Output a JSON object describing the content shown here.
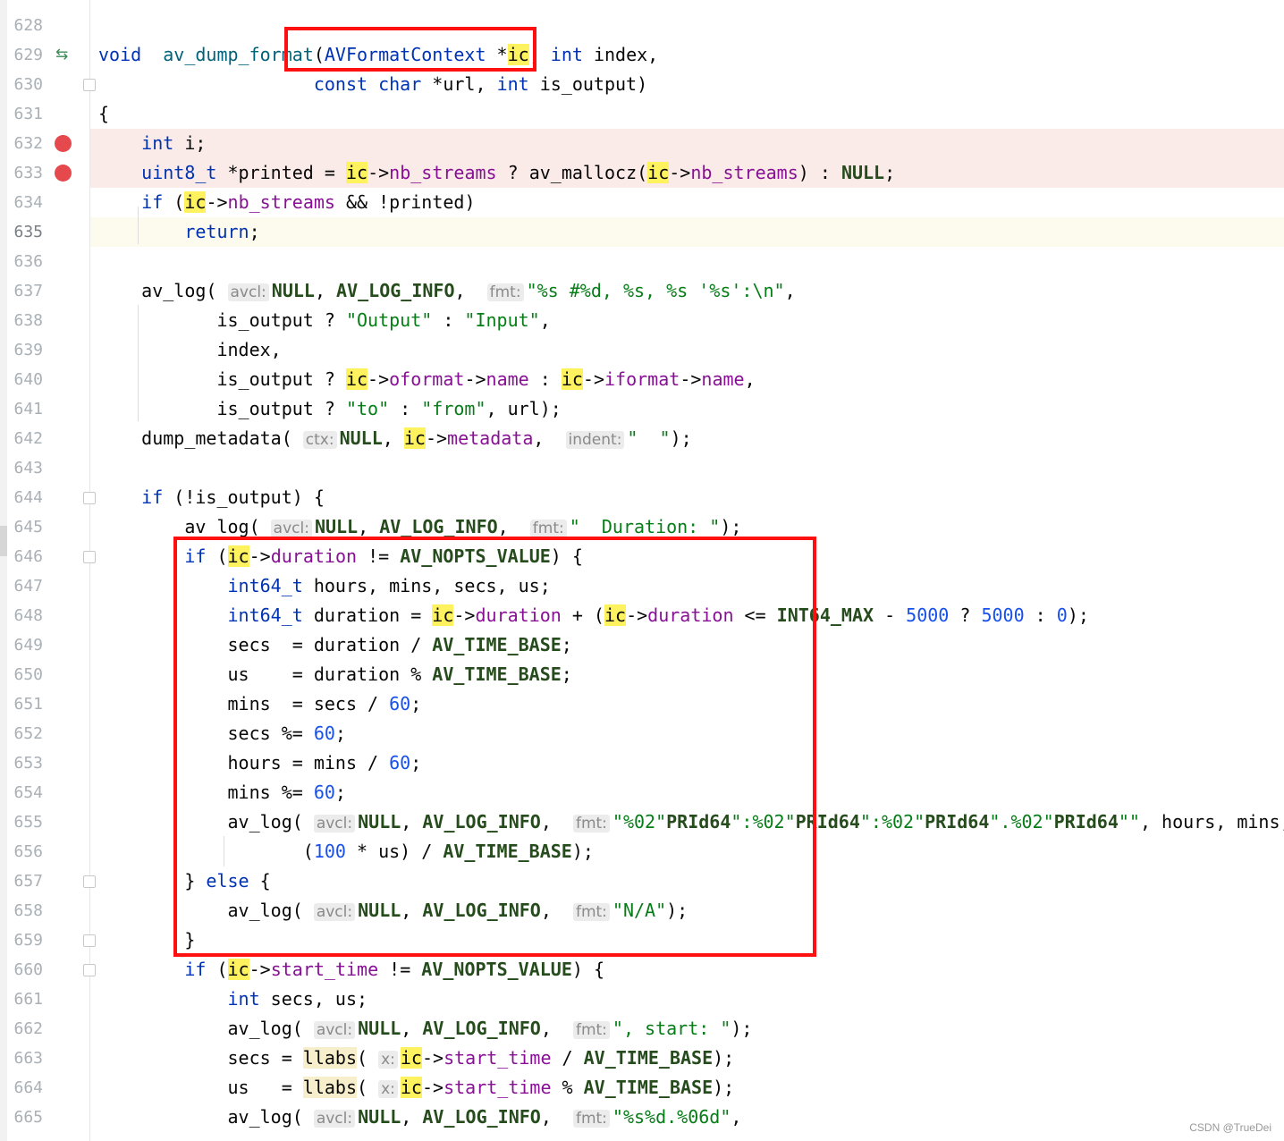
{
  "watermark": "CSDN @TrueDei",
  "rows": [
    {
      "ln": "628",
      "segs": []
    },
    {
      "ln": "629",
      "marker": "impl",
      "segs": [
        [
          "ty",
          "void"
        ],
        [
          "",
          "  "
        ],
        [
          "fn",
          "av_dump_format"
        ],
        [
          "",
          "("
        ],
        [
          "ty",
          "AVFormatContext"
        ],
        [
          "",
          " *"
        ],
        [
          "hl",
          "ic"
        ],
        [
          "",
          ", "
        ],
        [
          "kw",
          "int"
        ],
        [
          "",
          " index,"
        ]
      ]
    },
    {
      "ln": "630",
      "fold": true,
      "segs": [
        [
          "",
          "                    "
        ],
        [
          "kw",
          "const"
        ],
        [
          "",
          " "
        ],
        [
          "kw",
          "char"
        ],
        [
          "",
          " *url, "
        ],
        [
          "kw",
          "int"
        ],
        [
          "",
          " is_output)"
        ]
      ]
    },
    {
      "ln": "631",
      "segs": [
        [
          "",
          "{"
        ]
      ]
    },
    {
      "ln": "632",
      "marker": "bp",
      "segs": [
        [
          "",
          "    "
        ],
        [
          "kw",
          "int"
        ],
        [
          "",
          " i;"
        ]
      ]
    },
    {
      "ln": "633",
      "marker": "bp",
      "segs": [
        [
          "",
          "    "
        ],
        [
          "ty",
          "uint8_t"
        ],
        [
          "",
          " *printed = "
        ],
        [
          "hl",
          "ic"
        ],
        [
          "",
          "->"
        ],
        [
          "fld",
          "nb_streams"
        ],
        [
          "",
          " ? av_mallocz("
        ],
        [
          "hl",
          "ic"
        ],
        [
          "",
          "->"
        ],
        [
          "fld",
          "nb_streams"
        ],
        [
          "",
          ") : "
        ],
        [
          "mac",
          "NULL"
        ],
        [
          "",
          ";"
        ]
      ]
    },
    {
      "ln": "634",
      "segs": [
        [
          "",
          "    "
        ],
        [
          "kw",
          "if"
        ],
        [
          "",
          " ("
        ],
        [
          "hl",
          "ic"
        ],
        [
          "",
          "->"
        ],
        [
          "fld",
          "nb_streams"
        ],
        [
          "",
          " && !printed)"
        ]
      ]
    },
    {
      "ln": "635",
      "caret": true,
      "segs": [
        [
          "",
          "        "
        ],
        [
          "kw",
          "return"
        ],
        [
          "",
          ";"
        ]
      ]
    },
    {
      "ln": "636",
      "segs": []
    },
    {
      "ln": "637",
      "segs": [
        [
          "",
          "    av_log( "
        ],
        [
          "hint",
          "avcl:"
        ],
        [
          "mac",
          "NULL"
        ],
        [
          "",
          ", "
        ],
        [
          "mac",
          "AV_LOG_INFO"
        ],
        [
          "",
          ",  "
        ],
        [
          "hint",
          "fmt:"
        ],
        [
          "str",
          "\"%s #%d, %s, %s '%s':\\n\""
        ],
        [
          "",
          ","
        ]
      ]
    },
    {
      "ln": "638",
      "segs": [
        [
          "",
          "           is_output ? "
        ],
        [
          "str",
          "\"Output\""
        ],
        [
          "",
          " : "
        ],
        [
          "str",
          "\"Input\""
        ],
        [
          "",
          ","
        ]
      ]
    },
    {
      "ln": "639",
      "segs": [
        [
          "",
          "           index,"
        ]
      ]
    },
    {
      "ln": "640",
      "segs": [
        [
          "",
          "           is_output ? "
        ],
        [
          "hl",
          "ic"
        ],
        [
          "",
          "->"
        ],
        [
          "fld",
          "oformat"
        ],
        [
          "",
          "->"
        ],
        [
          "fld",
          "name"
        ],
        [
          "",
          " : "
        ],
        [
          "hl",
          "ic"
        ],
        [
          "",
          "->"
        ],
        [
          "fld",
          "iformat"
        ],
        [
          "",
          "->"
        ],
        [
          "fld",
          "name"
        ],
        [
          "",
          ","
        ]
      ]
    },
    {
      "ln": "641",
      "segs": [
        [
          "",
          "           is_output ? "
        ],
        [
          "str",
          "\"to\""
        ],
        [
          "",
          " : "
        ],
        [
          "str",
          "\"from\""
        ],
        [
          "",
          ", url);"
        ]
      ]
    },
    {
      "ln": "642",
      "segs": [
        [
          "",
          "    dump_metadata( "
        ],
        [
          "hint",
          "ctx:"
        ],
        [
          "mac",
          "NULL"
        ],
        [
          "",
          ", "
        ],
        [
          "hl",
          "ic"
        ],
        [
          "",
          "->"
        ],
        [
          "fld",
          "metadata"
        ],
        [
          "",
          ",  "
        ],
        [
          "hint",
          "indent:"
        ],
        [
          "str",
          "\"  \""
        ],
        [
          "",
          ");"
        ]
      ]
    },
    {
      "ln": "643",
      "segs": []
    },
    {
      "ln": "644",
      "fold": true,
      "segs": [
        [
          "",
          "    "
        ],
        [
          "kw",
          "if"
        ],
        [
          "",
          " (!is_output) {"
        ]
      ]
    },
    {
      "ln": "645",
      "segs": [
        [
          "",
          "        av_log( "
        ],
        [
          "hint",
          "avcl:"
        ],
        [
          "mac",
          "NULL"
        ],
        [
          "",
          ", "
        ],
        [
          "mac",
          "AV_LOG_INFO"
        ],
        [
          "",
          ",  "
        ],
        [
          "hint",
          "fmt:"
        ],
        [
          "str",
          "\"  Duration: \""
        ],
        [
          "",
          ");"
        ]
      ]
    },
    {
      "ln": "646",
      "fold": true,
      "segs": [
        [
          "",
          "        "
        ],
        [
          "kw",
          "if"
        ],
        [
          "",
          " ("
        ],
        [
          "hl",
          "ic"
        ],
        [
          "",
          "->"
        ],
        [
          "fld",
          "duration"
        ],
        [
          "",
          " != "
        ],
        [
          "mac",
          "AV_NOPTS_VALUE"
        ],
        [
          "",
          ") {"
        ]
      ]
    },
    {
      "ln": "647",
      "segs": [
        [
          "",
          "            "
        ],
        [
          "ty",
          "int64_t"
        ],
        [
          "",
          " hours, mins, secs, us;"
        ]
      ]
    },
    {
      "ln": "648",
      "segs": [
        [
          "",
          "            "
        ],
        [
          "ty",
          "int64_t"
        ],
        [
          "",
          " duration = "
        ],
        [
          "hl",
          "ic"
        ],
        [
          "",
          "->"
        ],
        [
          "fld",
          "duration"
        ],
        [
          "",
          " + ("
        ],
        [
          "hl",
          "ic"
        ],
        [
          "",
          "->"
        ],
        [
          "fld",
          "duration"
        ],
        [
          "",
          " <= "
        ],
        [
          "mac",
          "INT64_MAX"
        ],
        [
          "",
          " - "
        ],
        [
          "num",
          "5000"
        ],
        [
          "",
          " ? "
        ],
        [
          "num",
          "5000"
        ],
        [
          "",
          " : "
        ],
        [
          "num",
          "0"
        ],
        [
          "",
          ");"
        ]
      ]
    },
    {
      "ln": "649",
      "segs": [
        [
          "",
          "            secs  = duration / "
        ],
        [
          "mac",
          "AV_TIME_BASE"
        ],
        [
          "",
          ";"
        ]
      ]
    },
    {
      "ln": "650",
      "segs": [
        [
          "",
          "            us    = duration % "
        ],
        [
          "mac",
          "AV_TIME_BASE"
        ],
        [
          "",
          ";"
        ]
      ]
    },
    {
      "ln": "651",
      "segs": [
        [
          "",
          "            mins  = secs / "
        ],
        [
          "num",
          "60"
        ],
        [
          "",
          ";"
        ]
      ]
    },
    {
      "ln": "652",
      "segs": [
        [
          "",
          "            secs %= "
        ],
        [
          "num",
          "60"
        ],
        [
          "",
          ";"
        ]
      ]
    },
    {
      "ln": "653",
      "segs": [
        [
          "",
          "            hours = mins / "
        ],
        [
          "num",
          "60"
        ],
        [
          "",
          ";"
        ]
      ]
    },
    {
      "ln": "654",
      "segs": [
        [
          "",
          "            mins %= "
        ],
        [
          "num",
          "60"
        ],
        [
          "",
          ";"
        ]
      ]
    },
    {
      "ln": "655",
      "segs": [
        [
          "",
          "            av_log( "
        ],
        [
          "hint",
          "avcl:"
        ],
        [
          "mac",
          "NULL"
        ],
        [
          "",
          ", "
        ],
        [
          "mac",
          "AV_LOG_INFO"
        ],
        [
          "",
          ",  "
        ],
        [
          "hint",
          "fmt:"
        ],
        [
          "str",
          "\"%02\""
        ],
        [
          "mac",
          "PRId64"
        ],
        [
          "str",
          "\":%02\""
        ],
        [
          "mac",
          "PRId64"
        ],
        [
          "str",
          "\":%02\""
        ],
        [
          "mac",
          "PRId64"
        ],
        [
          "str",
          "\".%02\""
        ],
        [
          "mac",
          "PRId64"
        ],
        [
          "str",
          "\"\""
        ],
        [
          "",
          ", hours, mins,"
        ]
      ]
    },
    {
      "ln": "656",
      "segs": [
        [
          "",
          "                   ("
        ],
        [
          "num",
          "100"
        ],
        [
          "",
          " * us) / "
        ],
        [
          "mac",
          "AV_TIME_BASE"
        ],
        [
          "",
          ");"
        ]
      ]
    },
    {
      "ln": "657",
      "fold": true,
      "segs": [
        [
          "",
          "        } "
        ],
        [
          "kw",
          "else"
        ],
        [
          "",
          " {"
        ]
      ]
    },
    {
      "ln": "658",
      "segs": [
        [
          "",
          "            av_log( "
        ],
        [
          "hint",
          "avcl:"
        ],
        [
          "mac",
          "NULL"
        ],
        [
          "",
          ", "
        ],
        [
          "mac",
          "AV_LOG_INFO"
        ],
        [
          "",
          ",  "
        ],
        [
          "hint",
          "fmt:"
        ],
        [
          "str",
          "\"N/A\""
        ],
        [
          "",
          ");"
        ]
      ]
    },
    {
      "ln": "659",
      "fold": true,
      "segs": [
        [
          "",
          "        }"
        ]
      ]
    },
    {
      "ln": "660",
      "fold": true,
      "segs": [
        [
          "",
          "        "
        ],
        [
          "kw",
          "if"
        ],
        [
          "",
          " ("
        ],
        [
          "hl",
          "ic"
        ],
        [
          "",
          "->"
        ],
        [
          "fld",
          "start_time"
        ],
        [
          "",
          " != "
        ],
        [
          "mac",
          "AV_NOPTS_VALUE"
        ],
        [
          "",
          ") {"
        ]
      ]
    },
    {
      "ln": "661",
      "segs": [
        [
          "",
          "            "
        ],
        [
          "kw",
          "int"
        ],
        [
          "",
          " secs, us;"
        ]
      ]
    },
    {
      "ln": "662",
      "segs": [
        [
          "",
          "            av_log( "
        ],
        [
          "hint",
          "avcl:"
        ],
        [
          "mac",
          "NULL"
        ],
        [
          "",
          ", "
        ],
        [
          "mac",
          "AV_LOG_INFO"
        ],
        [
          "",
          ",  "
        ],
        [
          "hint",
          "fmt:"
        ],
        [
          "str",
          "\", start: \""
        ],
        [
          "",
          ");"
        ]
      ]
    },
    {
      "ln": "663",
      "segs": [
        [
          "",
          "            secs = "
        ],
        [
          "hl2",
          "llabs"
        ],
        [
          "",
          "( "
        ],
        [
          "hint",
          "x:"
        ],
        [
          "hl",
          "ic"
        ],
        [
          "",
          "->"
        ],
        [
          "fld",
          "start_time"
        ],
        [
          "",
          " / "
        ],
        [
          "mac",
          "AV_TIME_BASE"
        ],
        [
          "",
          ");"
        ]
      ]
    },
    {
      "ln": "664",
      "segs": [
        [
          "",
          "            us   = "
        ],
        [
          "hl2",
          "llabs"
        ],
        [
          "",
          "( "
        ],
        [
          "hint",
          "x:"
        ],
        [
          "hl",
          "ic"
        ],
        [
          "",
          "->"
        ],
        [
          "fld",
          "start_time"
        ],
        [
          "",
          " % "
        ],
        [
          "mac",
          "AV_TIME_BASE"
        ],
        [
          "",
          ");"
        ]
      ]
    },
    {
      "ln": "665",
      "segs": [
        [
          "",
          "            av_log( "
        ],
        [
          "hint",
          "avcl:"
        ],
        [
          "mac",
          "NULL"
        ],
        [
          "",
          ", "
        ],
        [
          "mac",
          "AV_LOG_INFO"
        ],
        [
          "",
          ",  "
        ],
        [
          "hint",
          "fmt:"
        ],
        [
          "str",
          "\"%s%d.%06d\""
        ],
        [
          "",
          ","
        ]
      ]
    }
  ]
}
